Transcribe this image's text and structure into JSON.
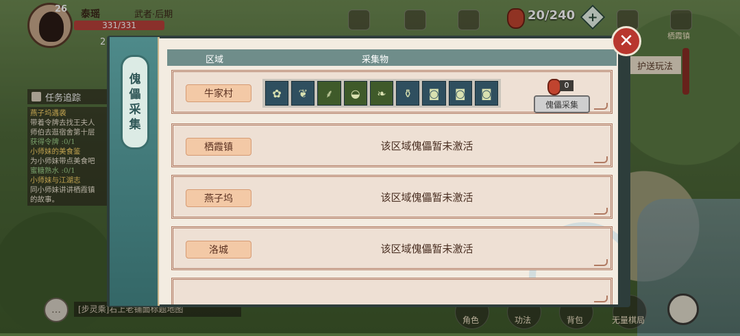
{
  "player": {
    "level": "26",
    "name": "泰瑶",
    "title": "武者·后期",
    "hp": "331/331",
    "sub_value": "2"
  },
  "resources": {
    "jar_count": "20/240",
    "add_icon": "plus-icon"
  },
  "top_right": {
    "label_1": "栖霞镇"
  },
  "quest_panel": {
    "header": "任务追踪",
    "quests": [
      {
        "title": "燕子坞遇袭",
        "desc": "带着令牌去找王夫人",
        "desc2": "师伯去逛宿舍第十层",
        "progress": "获得令牌 :0/1"
      },
      {
        "title": "小师妹的美食鉴",
        "desc": "为小师妹带点美食吧",
        "progress": "蜜糖熟水 :0/1"
      },
      {
        "title": "小师妹与江湖志",
        "desc": "同小师妹讲讲栖霞镇",
        "desc2": "的故事。"
      }
    ]
  },
  "right_panel": {
    "escort": "护送玩法"
  },
  "chat": {
    "line": "[步灵乘]右上老铺面标题地图"
  },
  "bottom_nav": [
    {
      "label": "角色",
      "icon": "character-icon"
    },
    {
      "label": "功法",
      "icon": "skill-icon"
    },
    {
      "label": "背包",
      "icon": "bag-icon"
    },
    {
      "label": "无量棋局",
      "icon": "chess-icon"
    }
  ],
  "modal": {
    "tab_title": [
      "傀",
      "儡",
      "采",
      "集"
    ],
    "col_region": "区域",
    "col_items": "采集物",
    "rows": [
      {
        "region": "牛家村",
        "active": true,
        "jar_count": "0",
        "button": "傀儡采集"
      },
      {
        "region": "栖霞镇",
        "active": false,
        "status": "该区域傀儡暂未激活"
      },
      {
        "region": "燕子坞",
        "active": false,
        "status": "该区域傀儡暂未激活"
      },
      {
        "region": "洛城",
        "active": false,
        "status": "该区域傀儡暂未激活"
      }
    ],
    "items": [
      "herb-icon",
      "leaf-icon",
      "twig-icon",
      "bowl-icon",
      "feather-icon",
      "bottle-icon",
      "jade-icon",
      "jade-icon",
      "jade-icon"
    ],
    "close_icon": "close-icon"
  }
}
